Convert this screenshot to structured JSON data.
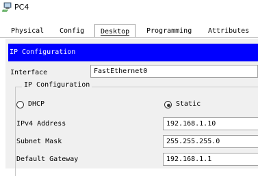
{
  "window": {
    "title": "PC4",
    "icon": "pc-icon"
  },
  "tabs": [
    {
      "label": "Physical"
    },
    {
      "label": "Config"
    },
    {
      "label": "Desktop",
      "active": true
    },
    {
      "label": "Programming"
    },
    {
      "label": "Attributes"
    }
  ],
  "header": {
    "title": "IP Configuration",
    "color": "#0000ff"
  },
  "interface": {
    "label": "Interface",
    "value": "FastEthernet0"
  },
  "ip_config": {
    "legend": "IP Configuration",
    "dhcp_label": "DHCP",
    "static_label": "Static",
    "selected": "Static",
    "ipv4_label": "IPv4 Address",
    "ipv4_value": "192.168.1.10",
    "subnet_label": "Subnet Mask",
    "subnet_value": "255.255.255.0",
    "gateway_label": "Default Gateway",
    "gateway_value": "192.168.1.1"
  }
}
